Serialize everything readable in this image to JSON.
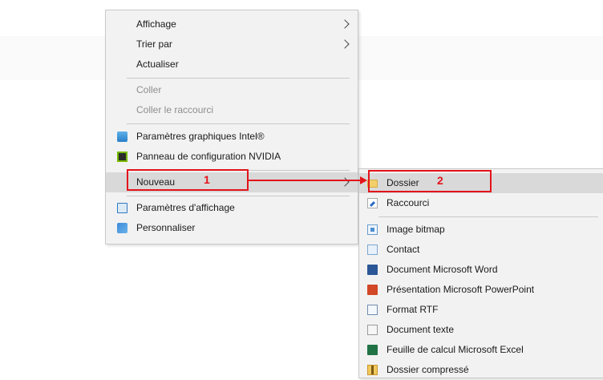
{
  "context_menu": {
    "items": [
      {
        "label": "Affichage"
      },
      {
        "label": "Trier par"
      },
      {
        "label": "Actualiser"
      },
      {
        "label": "Coller"
      },
      {
        "label": "Coller le raccourci"
      },
      {
        "label": "Paramètres graphiques Intel®",
        "icon": "intel-graphics-icon"
      },
      {
        "label": "Panneau de configuration NVIDIA",
        "icon": "nvidia-icon"
      },
      {
        "label": "Nouveau"
      },
      {
        "label": "Paramètres d'affichage",
        "icon": "display-settings-icon"
      },
      {
        "label": "Personnaliser",
        "icon": "personalize-icon"
      }
    ]
  },
  "submenu_new": {
    "items": [
      {
        "label": "Dossier",
        "icon": "folder-icon"
      },
      {
        "label": "Raccourci",
        "icon": "shortcut-icon"
      },
      {
        "label": "Image bitmap",
        "icon": "bitmap-icon"
      },
      {
        "label": "Contact",
        "icon": "contact-icon"
      },
      {
        "label": "Document Microsoft Word",
        "icon": "word-icon"
      },
      {
        "label": "Présentation Microsoft PowerPoint",
        "icon": "powerpoint-icon"
      },
      {
        "label": "Format RTF",
        "icon": "rtf-icon"
      },
      {
        "label": "Document texte",
        "icon": "text-document-icon"
      },
      {
        "label": "Feuille de calcul Microsoft Excel",
        "icon": "excel-icon"
      },
      {
        "label": "Dossier compressé",
        "icon": "zip-folder-icon"
      }
    ]
  },
  "annotations": {
    "step1": "1",
    "step2": "2",
    "color": "#e3131b"
  }
}
